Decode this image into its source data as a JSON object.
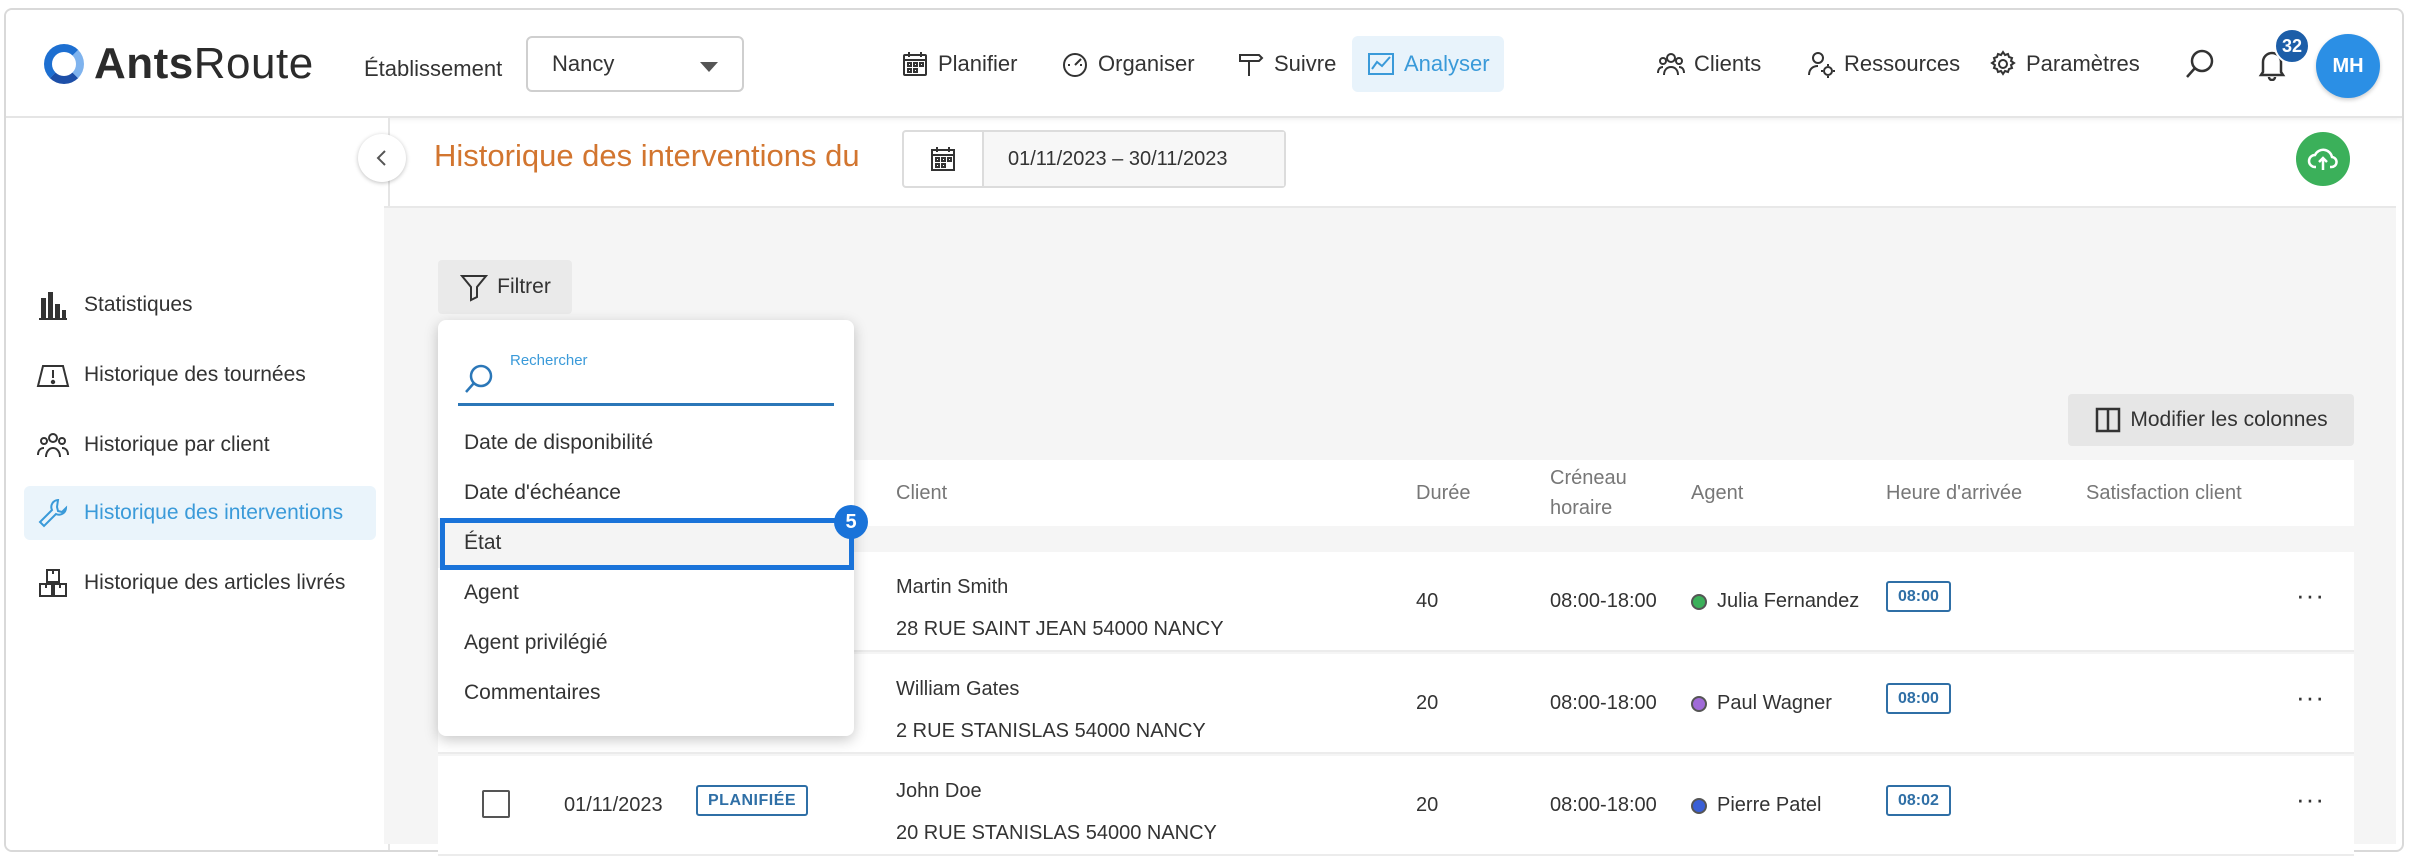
{
  "app": {
    "logo_bold": "Ants",
    "logo_light": "Route"
  },
  "header": {
    "establishment_label": "Établissement",
    "establishment_value": "Nancy",
    "nav": [
      {
        "label": "Planifier",
        "icon": "calendar-icon"
      },
      {
        "label": "Organiser",
        "icon": "gauge-icon"
      },
      {
        "label": "Suivre",
        "icon": "signpost-icon"
      },
      {
        "label": "Analyser",
        "icon": "chart-icon"
      }
    ],
    "right_nav": [
      {
        "label": "Clients",
        "icon": "users-icon"
      },
      {
        "label": "Ressources",
        "icon": "user-gear-icon"
      },
      {
        "label": "Paramètres",
        "icon": "gear-icon"
      }
    ],
    "notification_count": "32",
    "avatar_initials": "MH"
  },
  "sidebar": {
    "items": [
      {
        "label": "Statistiques",
        "icon": "bar-chart-icon"
      },
      {
        "label": "Historique des tournées",
        "icon": "map-icon"
      },
      {
        "label": "Historique par client",
        "icon": "clients-icon"
      },
      {
        "label": "Historique des interventions",
        "icon": "wrench-icon",
        "active": true
      },
      {
        "label": "Historique des articles livrés",
        "icon": "boxes-icon"
      }
    ]
  },
  "main": {
    "title": "Historique des interventions du",
    "date_range": "01/11/2023 – 30/11/2023",
    "filter_label": "Filtrer",
    "columns_button": "Modifier les colonnes"
  },
  "filter_dropdown": {
    "search_placeholder": "Rechercher",
    "options": [
      "Date de disponibilité",
      "Date d'échéance",
      "État",
      "Agent",
      "Agent privilégié",
      "Commentaires"
    ],
    "highlighted_step": "5"
  },
  "table": {
    "headers": {
      "client": "Client",
      "duree": "Durée",
      "creneau_line1": "Créneau",
      "creneau_line2": "horaire",
      "agent": "Agent",
      "heure": "Heure d'arrivée",
      "satisfaction": "Satisfaction client"
    },
    "rows": [
      {
        "date": "",
        "status": "",
        "client": "Martin Smith",
        "address": "28 RUE SAINT JEAN 54000 NANCY",
        "duree": "40",
        "creneau": "08:00-18:00",
        "agent": "Julia Fernandez",
        "agent_color": "#3bb05a",
        "heure": "08:00",
        "more": "···"
      },
      {
        "date": "",
        "status": "",
        "client": "William Gates",
        "address": "2 RUE STANISLAS 54000 NANCY",
        "duree": "20",
        "creneau": "08:00-18:00",
        "agent": "Paul Wagner",
        "agent_color": "#a06ad8",
        "heure": "08:00",
        "more": "···"
      },
      {
        "date": "01/11/2023",
        "status": "PLANIFIÉE",
        "client": "John Doe",
        "address": "20 RUE STANISLAS 54000 NANCY",
        "duree": "20",
        "creneau": "08:00-18:00",
        "agent": "Pierre Patel",
        "agent_color": "#3a5fd6",
        "heure": "08:02",
        "more": "···"
      }
    ]
  }
}
